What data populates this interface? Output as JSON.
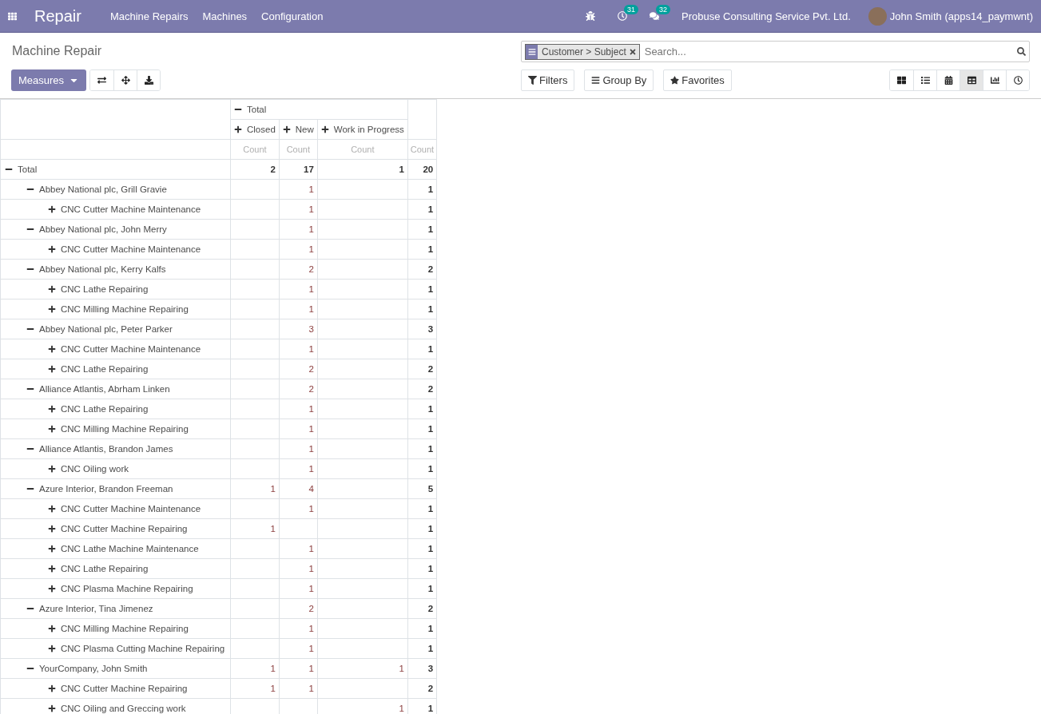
{
  "navbar": {
    "app_name": "Repair",
    "menu": [
      "Machine Repairs",
      "Machines",
      "Configuration"
    ],
    "activity_count": "31",
    "message_count": "32",
    "company": "Probuse Consulting Service Pvt. Ltd.",
    "user": "John Smith (apps14_paymwnt)"
  },
  "breadcrumb": "Machine Repair",
  "measures_button": "Measures",
  "search": {
    "facet": "Customer > Subject",
    "placeholder": "Search..."
  },
  "filter_buttons": [
    {
      "kind": "filter",
      "label": "Filters"
    },
    {
      "kind": "groupby",
      "label": "Group By"
    },
    {
      "kind": "favorites",
      "label": "Favorites"
    }
  ],
  "views": [
    {
      "kind": "kanban",
      "selected": false
    },
    {
      "kind": "list",
      "selected": false
    },
    {
      "kind": "calendar",
      "selected": false
    },
    {
      "kind": "pivot",
      "selected": true
    },
    {
      "kind": "graph",
      "selected": false
    },
    {
      "kind": "activity",
      "selected": false
    }
  ],
  "pivot": {
    "column_header": {
      "label": "Total",
      "expanded": true,
      "groups": [
        {
          "label": "Closed",
          "expanded": false
        },
        {
          "label": "New",
          "expanded": false
        },
        {
          "label": "Work in Progress",
          "expanded": false
        }
      ]
    },
    "measures": [
      "Count",
      "Count",
      "Count",
      "Count"
    ],
    "rows": [
      {
        "label": "Total",
        "expanded": true,
        "cells": {
          "closed": "2",
          "new": "17",
          "work_in_progress": "1",
          "total": "20"
        },
        "children": [
          {
            "label": "Abbey National plc, Grill Gravie",
            "expanded": true,
            "cells": {
              "new": "1",
              "total": "1"
            },
            "children": [
              {
                "label": "CNC Cutter Machine Maintenance",
                "expanded": false,
                "cells": {
                  "new": "1",
                  "total": "1"
                }
              }
            ]
          },
          {
            "label": "Abbey National plc, John Merry",
            "expanded": true,
            "cells": {
              "new": "1",
              "total": "1"
            },
            "children": [
              {
                "label": "CNC Cutter Machine Maintenance",
                "expanded": false,
                "cells": {
                  "new": "1",
                  "total": "1"
                }
              }
            ]
          },
          {
            "label": "Abbey National plc, Kerry Kalfs",
            "expanded": true,
            "cells": {
              "new": "2",
              "total": "2"
            },
            "children": [
              {
                "label": "CNC Lathe Repairing",
                "expanded": false,
                "cells": {
                  "new": "1",
                  "total": "1"
                }
              },
              {
                "label": "CNC Milling Machine Repairing",
                "expanded": false,
                "cells": {
                  "new": "1",
                  "total": "1"
                }
              }
            ]
          },
          {
            "label": "Abbey National plc, Peter Parker",
            "expanded": true,
            "cells": {
              "new": "3",
              "total": "3"
            },
            "children": [
              {
                "label": "CNC Cutter Machine Maintenance",
                "expanded": false,
                "cells": {
                  "new": "1",
                  "total": "1"
                }
              },
              {
                "label": "CNC Lathe Repairing",
                "expanded": false,
                "cells": {
                  "new": "2",
                  "total": "2"
                }
              }
            ]
          },
          {
            "label": "Alliance Atlantis, Abrham Linken",
            "expanded": true,
            "cells": {
              "new": "2",
              "total": "2"
            },
            "children": [
              {
                "label": "CNC Lathe Repairing",
                "expanded": false,
                "cells": {
                  "new": "1",
                  "total": "1"
                }
              },
              {
                "label": "CNC Milling Machine Repairing",
                "expanded": false,
                "cells": {
                  "new": "1",
                  "total": "1"
                }
              }
            ]
          },
          {
            "label": "Alliance Atlantis, Brandon James",
            "expanded": true,
            "cells": {
              "new": "1",
              "total": "1"
            },
            "children": [
              {
                "label": "CNC Oiling work",
                "expanded": false,
                "cells": {
                  "new": "1",
                  "total": "1"
                }
              }
            ]
          },
          {
            "label": "Azure Interior, Brandon Freeman",
            "expanded": true,
            "cells": {
              "closed": "1",
              "new": "4",
              "total": "5"
            },
            "children": [
              {
                "label": "CNC Cutter Machine Maintenance",
                "expanded": false,
                "cells": {
                  "new": "1",
                  "total": "1"
                }
              },
              {
                "label": "CNC Cutter Machine Repairing",
                "expanded": false,
                "cells": {
                  "closed": "1",
                  "total": "1"
                }
              },
              {
                "label": "CNC Lathe Machine Maintenance",
                "expanded": false,
                "cells": {
                  "new": "1",
                  "total": "1"
                }
              },
              {
                "label": "CNC Lathe Repairing",
                "expanded": false,
                "cells": {
                  "new": "1",
                  "total": "1"
                }
              },
              {
                "label": "CNC Plasma Machine Repairing",
                "expanded": false,
                "cells": {
                  "new": "1",
                  "total": "1"
                }
              }
            ]
          },
          {
            "label": "Azure Interior, Tina Jimenez",
            "expanded": true,
            "cells": {
              "new": "2",
              "total": "2"
            },
            "children": [
              {
                "label": "CNC Milling Machine Repairing",
                "expanded": false,
                "cells": {
                  "new": "1",
                  "total": "1"
                }
              },
              {
                "label": "CNC Plasma Cutting Machine Repairing",
                "expanded": false,
                "cells": {
                  "new": "1",
                  "total": "1"
                }
              }
            ]
          },
          {
            "label": "YourCompany, John Smith",
            "expanded": true,
            "cells": {
              "closed": "1",
              "new": "1",
              "work_in_progress": "1",
              "total": "3"
            },
            "children": [
              {
                "label": "CNC Cutter Machine Repairing",
                "expanded": false,
                "cells": {
                  "closed": "1",
                  "new": "1",
                  "total": "2"
                }
              },
              {
                "label": "CNC Oiling and Greccing work",
                "expanded": false,
                "cells": {
                  "work_in_progress": "1",
                  "total": "1"
                }
              }
            ]
          }
        ]
      }
    ]
  }
}
